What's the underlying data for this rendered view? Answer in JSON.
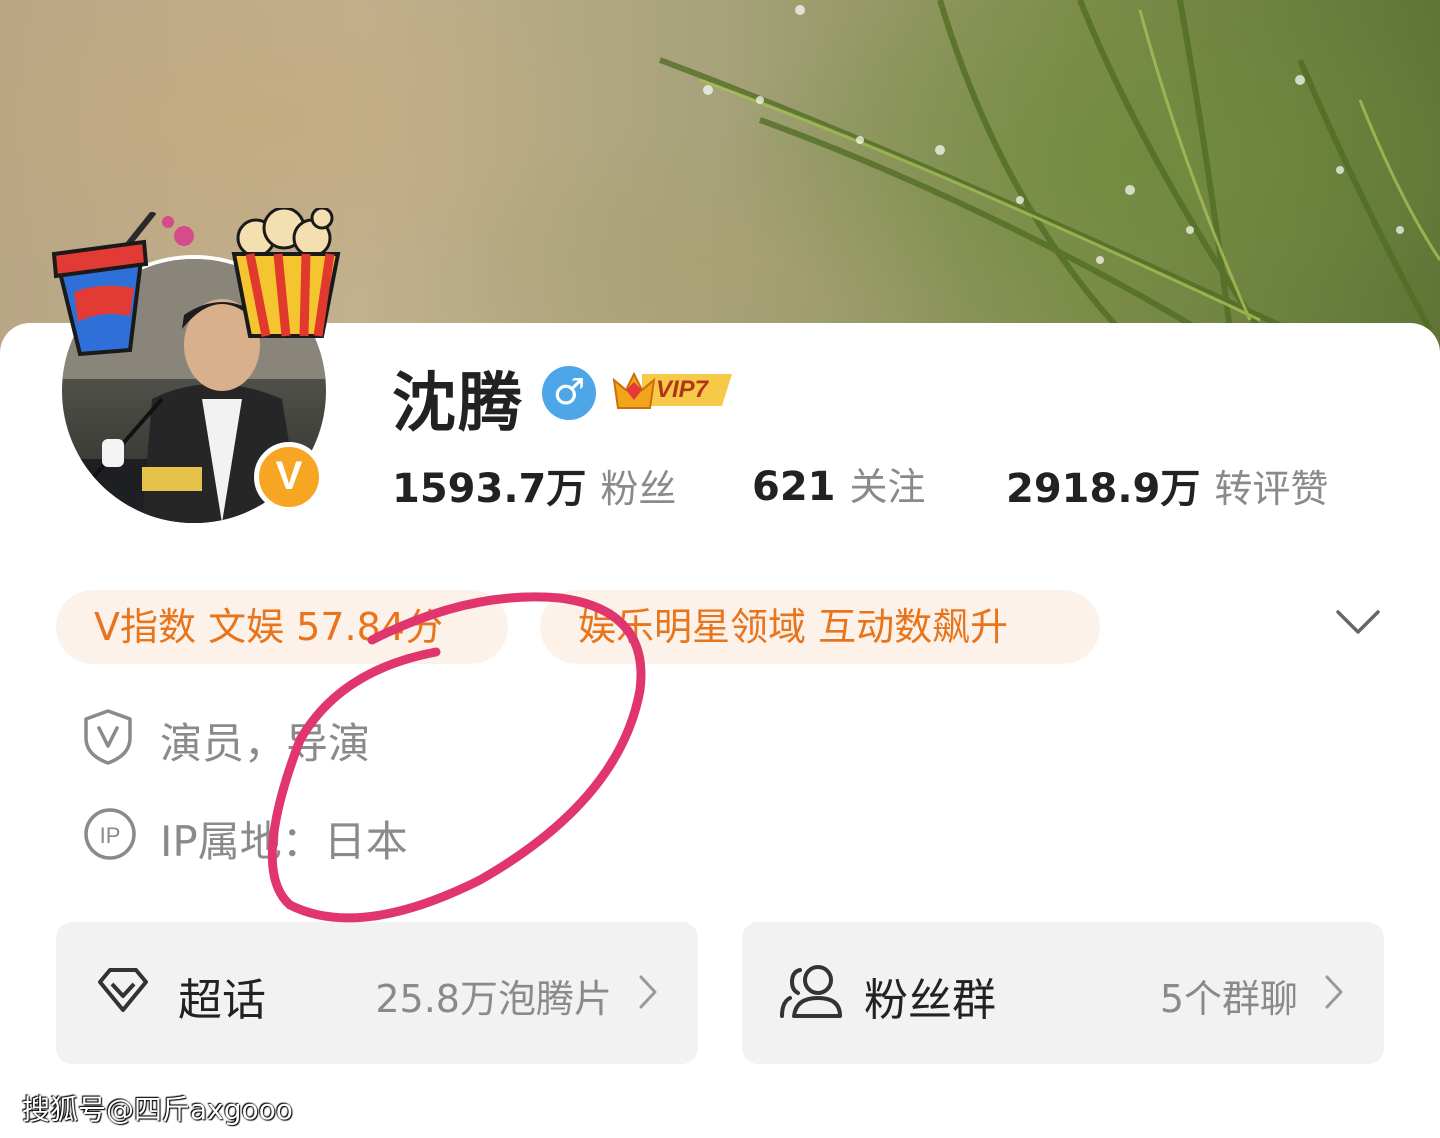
{
  "profile": {
    "name": "沈腾",
    "vip_label": "VIP7",
    "verified_badge": "V"
  },
  "stats": [
    {
      "value": "1593.7万",
      "label": "粉丝"
    },
    {
      "value": "621",
      "label": "关注"
    },
    {
      "value": "2918.9万",
      "label": "转评赞"
    }
  ],
  "tags": [
    "V指数 文娱 57.84分",
    "娱乐明星领域 互动数飙升"
  ],
  "info": {
    "occupation": "演员，导演",
    "ip_location": "IP属地：日本"
  },
  "entries": [
    {
      "label": "超话",
      "value": "25.8万泡腾片",
      "icon": "diamond-icon"
    },
    {
      "label": "粉丝群",
      "value": "5个群聊",
      "icon": "fan-group-icon"
    }
  ],
  "watermark": "搜狐号@四斤axgooo",
  "colors": {
    "accent_orange": "#e8741c",
    "tag_bg": "#fdf2ea",
    "gender_blue": "#4da6e8",
    "badge_gold": "#f6a623",
    "annotation_pink": "#e0356d"
  }
}
